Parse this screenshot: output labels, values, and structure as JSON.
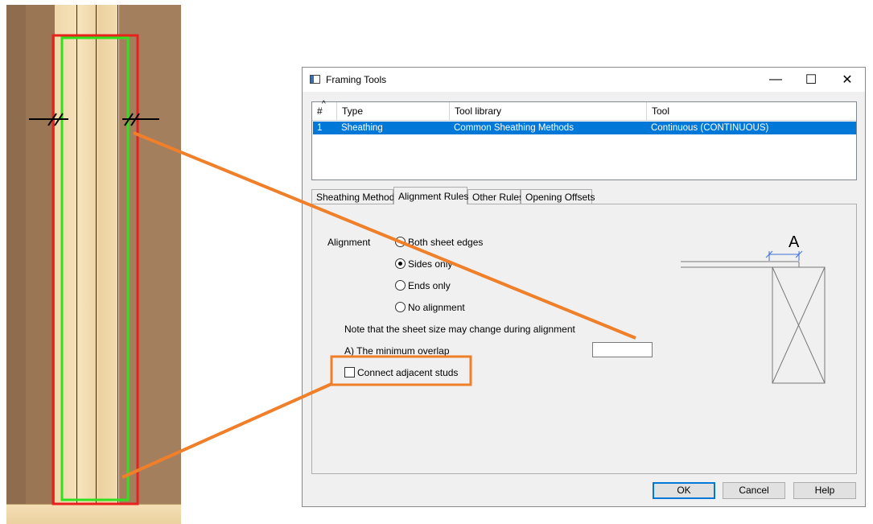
{
  "window": {
    "title": "Framing Tools",
    "minimize_glyph": "—",
    "maximize_glyph": "☐",
    "close_glyph": "✕"
  },
  "grid": {
    "sort_glyph": "^",
    "headers": [
      "#",
      "Type",
      "Tool library",
      "Tool"
    ],
    "rows": [
      {
        "num": "1",
        "type": "Sheathing",
        "library": "Common Sheathing Methods",
        "tool": "Continuous (CONTINUOUS)"
      }
    ]
  },
  "tabs": [
    "Sheathing Methods",
    "Alignment Rules",
    "Other Rules",
    "Opening Offsets"
  ],
  "active_tab": "Alignment Rules",
  "alignment": {
    "label": "Alignment",
    "options": [
      {
        "label": "Both sheet edges",
        "checked": false
      },
      {
        "label": "Sides only",
        "checked": true
      },
      {
        "label": "Ends only",
        "checked": false
      },
      {
        "label": "No alignment",
        "checked": false
      }
    ],
    "note": "Note that the sheet size may change during alignment",
    "min_overlap_label": "A) The minimum overlap",
    "min_overlap_value": "",
    "connect_studs_label": "Connect adjacent studs",
    "connect_studs_checked": false,
    "diagram_label": "A"
  },
  "buttons": {
    "ok": "OK",
    "cancel": "Cancel",
    "help": "Help"
  },
  "colors": {
    "selection": "#0078d7",
    "callout": "#f07f2a",
    "outline_red": "#e8211d",
    "outline_green": "#2fe21f"
  }
}
